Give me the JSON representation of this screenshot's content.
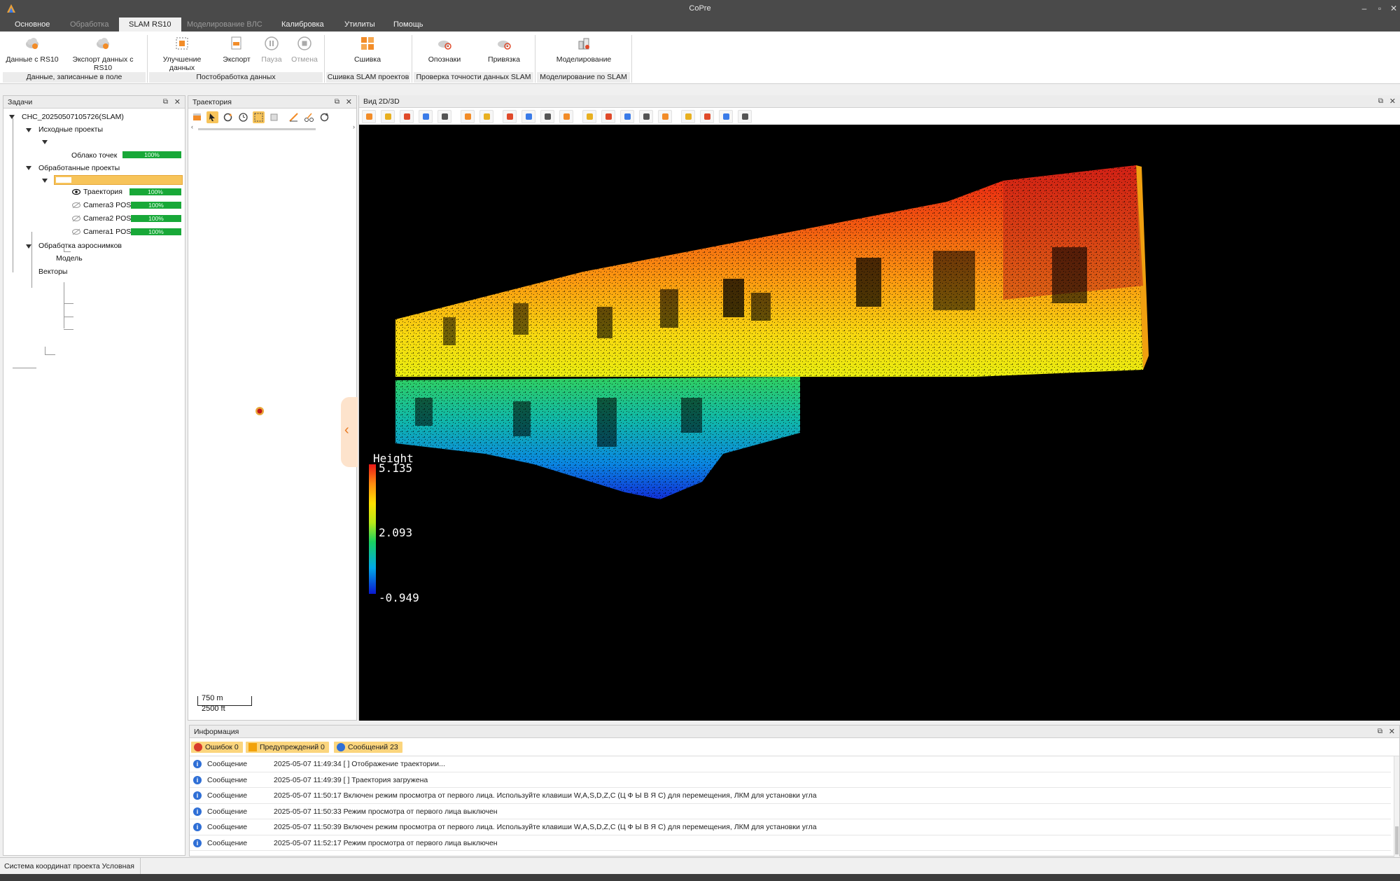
{
  "window": {
    "title": "CoPre"
  },
  "tabs": [
    {
      "label": "Основное",
      "state": "normal"
    },
    {
      "label": "Обработка",
      "state": "disabled"
    },
    {
      "label": "SLAM RS10",
      "state": "active"
    },
    {
      "label": "Моделирование ВЛС",
      "state": "disabled"
    },
    {
      "label": "Калибровка",
      "state": "normal"
    },
    {
      "label": "Утилиты",
      "state": "normal"
    },
    {
      "label": "Помощь",
      "state": "normal"
    }
  ],
  "ribbon": {
    "buttons": {
      "data_rs10": "Данные с RS10",
      "export_rs10": "Экспорт данных с RS10",
      "enhance": "Улучшение данных",
      "export": "Экспорт",
      "pause": "Пауза",
      "cancel": "Отмена",
      "stitch": "Сшивка",
      "control_points": "Опознаки",
      "binding": "Привязка",
      "modeling": "Моделирование"
    },
    "groups": {
      "field_data": "Данные, записанные в поле",
      "postprocessing": "Постобработка данных",
      "stitch_projects": "Сшивка SLAM проектов",
      "accuracy_check": "Проверка точности данных SLAM",
      "slam_modeling": "Моделирование по SLAM"
    }
  },
  "tasks_panel": {
    "title": "Задачи",
    "root": "CHC_20250507105726(SLAM)",
    "source_projects": "Исходные проекты",
    "point_cloud": "Облако точек",
    "processed_projects": "Обработанные проекты",
    "trajectory": "Траектория",
    "camera3": "Camera3 POS",
    "camera2": "Camera2 POS",
    "camera1": "Camera1 POS",
    "aerial": "Обработка аэроснимков",
    "model": "Модель",
    "vectors": "Векторы",
    "progress_label": "100%",
    "progress_value": 1.0
  },
  "trajectory_panel": {
    "title": "Траектория",
    "scale_m": "750 m",
    "scale_ft": "2500 ft"
  },
  "view_panel": {
    "title": "Вид 2D/3D",
    "legend": {
      "title": "Height",
      "max": "5.135",
      "mid": "2.093",
      "min": "-0.949"
    }
  },
  "info_panel": {
    "title": "Информация",
    "filters": {
      "errors": "Ошибок 0",
      "warnings": "Предупреждений 0",
      "messages": "Сообщений 23"
    },
    "rows": [
      {
        "type": "Сообщение",
        "text": "2025-05-07 11:49:34 [         ] Отображение траектории..."
      },
      {
        "type": "Сообщение",
        "text": "2025-05-07 11:49:39 [         ] Траектория загружена"
      },
      {
        "type": "Сообщение",
        "text": "2025-05-07 11:50:17 Включен режим просмотра от первого лица. Используйте клавиши W,A,S,D,Z,C (Ц Ф Ы В Я С) для перемещения, ЛКМ для установки угла"
      },
      {
        "type": "Сообщение",
        "text": "2025-05-07 11:50:33 Режим просмотра от первого лица выключен"
      },
      {
        "type": "Сообщение",
        "text": "2025-05-07 11:50:39 Включен режим просмотра от первого лица. Используйте клавиши W,A,S,D,Z,C (Ц Ф Ы В Я С) для перемещения, ЛКМ для установки угла"
      },
      {
        "type": "Сообщение",
        "text": "2025-05-07 11:52:17 Режим просмотра от первого лица выключен"
      }
    ]
  },
  "statusbar": {
    "text": "Система координат проекта Условная"
  },
  "colors": {
    "progress": "#18a838",
    "highlight": "#f7c45a",
    "info": "#2f6fd6"
  }
}
